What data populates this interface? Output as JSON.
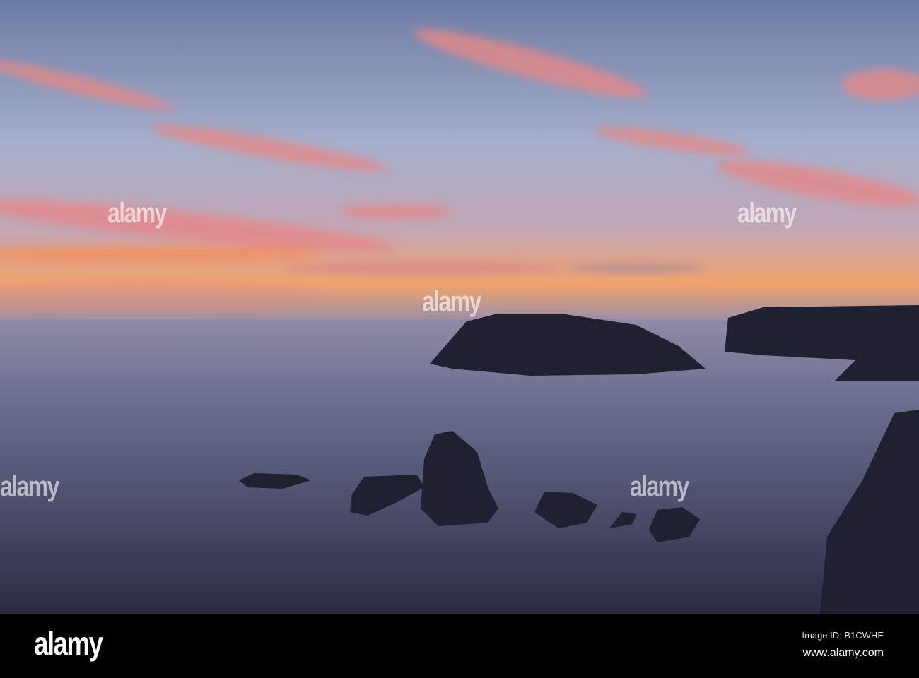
{
  "photo": {
    "subject": "Sunset over sea with island and rock silhouettes",
    "colors": {
      "sky_top": "#6e7ea6",
      "sky_mid": "#a4aecb",
      "horizon": "#f2a06a",
      "sea_top": "#8a8aa6",
      "sea_bottom": "#2b2d45",
      "cloud": "#e88a8a",
      "rock": "#1f2030"
    }
  },
  "watermark": {
    "text": "alamy"
  },
  "footer": {
    "logo": "alamy",
    "image_id": "Image ID: B1CWHE",
    "website": "www.alamy.com"
  }
}
